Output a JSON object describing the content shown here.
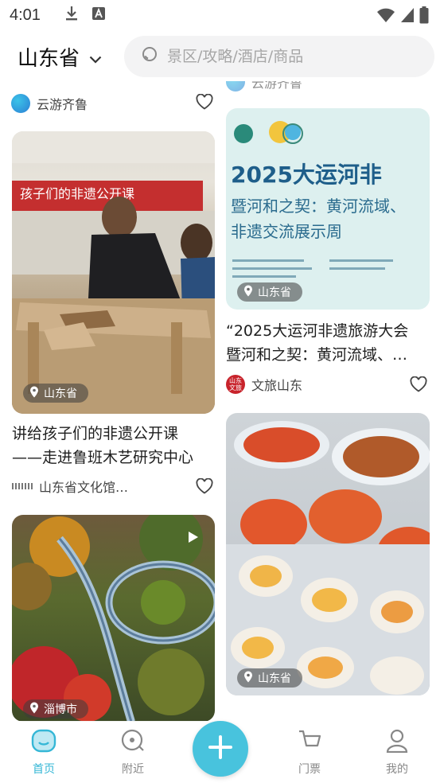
{
  "status_bar": {
    "time": "4:01"
  },
  "header": {
    "province": "山东省",
    "search_placeholder": "景区/攻略/酒店/商品"
  },
  "feed": {
    "left": [
      {
        "author": "云游齐鲁"
      },
      {
        "title_line1": "讲给孩子们的非遗公开课",
        "title_line2": "——走进鲁班木艺研究中心",
        "location": "山东省",
        "banner_text": "孩子们的非遗公开课",
        "author": "山东省文化馆…"
      },
      {
        "location": "淄博市"
      }
    ],
    "right": [
      {
        "author": "云游齐鲁"
      },
      {
        "poster_line1": "2025大运河非",
        "poster_line2": "暨河和之契：黄河流域、",
        "poster_line3": "非遗交流展示周",
        "title_line1": "“2025大运河非遗旅游大会",
        "title_line2": "暨河和之契：黄河流域、…",
        "location": "山东省",
        "author": "文旅山东",
        "author_avatar_text": "山东文旅"
      },
      {
        "location": "山东省"
      }
    ]
  },
  "bottom_nav": {
    "items": [
      {
        "label": "首页"
      },
      {
        "label": "附近"
      },
      {
        "label": "门票"
      },
      {
        "label": "我的"
      }
    ]
  },
  "colors": {
    "accent": "#48c3dd",
    "active_nav": "#35b7d6"
  }
}
